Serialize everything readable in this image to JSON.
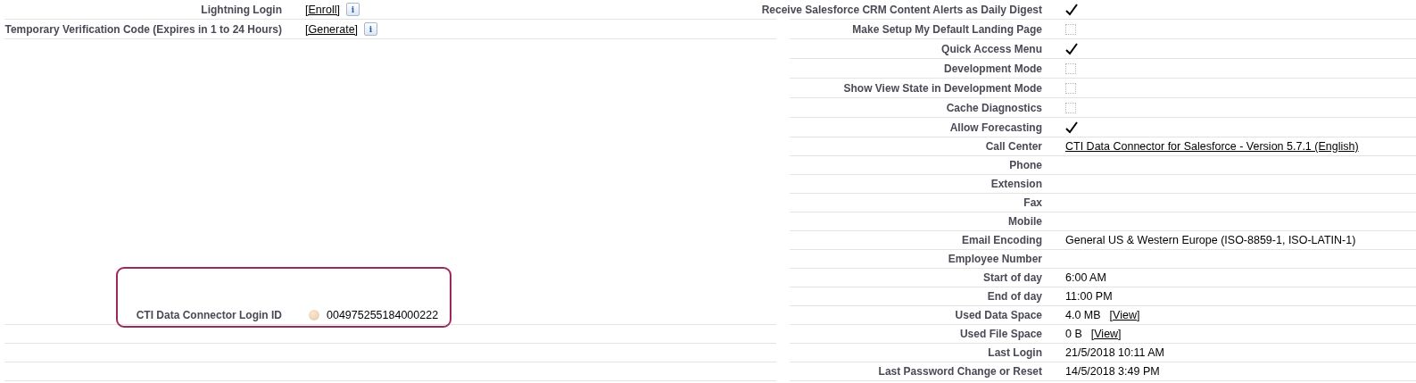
{
  "left_fields": [
    {
      "label": "Lightning Login",
      "kind": "link_info",
      "link": "[Enroll]",
      "info_icon": "i"
    },
    {
      "label": "Temporary Verification Code (Expires in 1 to 24 Hours)",
      "kind": "link_info",
      "link": "[Generate]",
      "info_icon": "i"
    },
    {
      "label": "CTI Data Connector Login ID",
      "kind": "help_value",
      "value": "004975255184000222",
      "highlighted": true
    }
  ],
  "right_fields": [
    {
      "label": "Receive Salesforce CRM Content Alerts as Daily Digest",
      "kind": "checkbox",
      "checked": true
    },
    {
      "label": "Make Setup My Default Landing Page",
      "kind": "checkbox",
      "checked": false
    },
    {
      "label": "Quick Access Menu",
      "kind": "checkbox",
      "checked": true
    },
    {
      "label": "Development Mode",
      "kind": "checkbox",
      "checked": false
    },
    {
      "label": "Show View State in Development Mode",
      "kind": "checkbox",
      "checked": false
    },
    {
      "label": "Cache Diagnostics",
      "kind": "checkbox",
      "checked": false
    },
    {
      "label": "Allow Forecasting",
      "kind": "checkbox",
      "checked": true
    },
    {
      "label": "Call Center",
      "kind": "link",
      "link": "CTI Data Connector for Salesforce - Version 5.7.1 (English)"
    },
    {
      "label": "Phone",
      "kind": "text"
    },
    {
      "label": "Extension",
      "kind": "text"
    },
    {
      "label": "Fax",
      "kind": "text"
    },
    {
      "label": "Mobile",
      "kind": "text"
    },
    {
      "label": "Email Encoding",
      "kind": "text",
      "value": "General US & Western Europe (ISO-8859-1, ISO-LATIN-1)"
    },
    {
      "label": "Employee Number",
      "kind": "text"
    },
    {
      "label": "Start of day",
      "kind": "text",
      "value": "6:00 AM"
    },
    {
      "label": "End of day",
      "kind": "text",
      "value": "11:00 PM"
    },
    {
      "label": "Used Data Space",
      "kind": "value_link",
      "value": "4.0 MB",
      "link": "[View]"
    },
    {
      "label": "Used File Space",
      "kind": "value_link",
      "value": "0 B",
      "link": "[View]"
    },
    {
      "label": "Last Login",
      "kind": "text",
      "value": "21/5/2018 10:11 AM"
    },
    {
      "label": "Last Password Change or Reset",
      "kind": "text",
      "value": "14/5/2018 3:49 PM"
    }
  ]
}
